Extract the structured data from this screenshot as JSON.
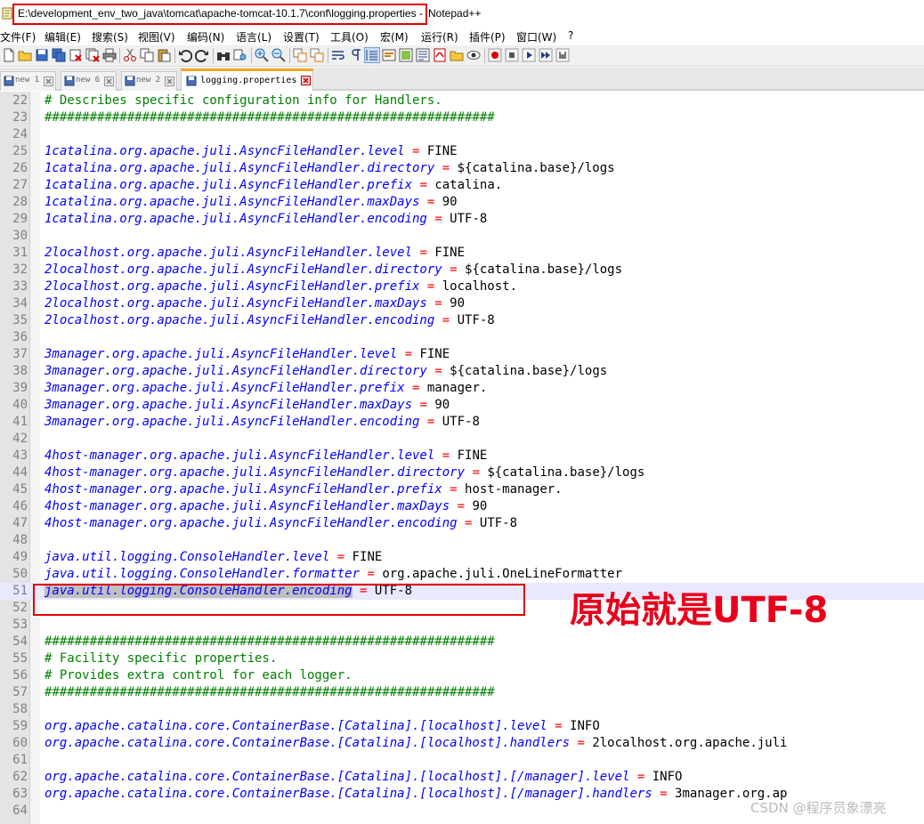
{
  "window": {
    "title_path": "E:\\development_env_two_java\\tomcat\\apache-tomcat-10.1.7\\conf\\logging.properties -",
    "app_name": "Notepad++"
  },
  "menu": [
    {
      "label": "文件(F)"
    },
    {
      "label": "编辑(E)"
    },
    {
      "label": "搜索(S)"
    },
    {
      "label": "视图(V)"
    },
    {
      "label": "编码(N)"
    },
    {
      "label": "语言(L)"
    },
    {
      "label": "设置(T)"
    },
    {
      "label": "工具(O)"
    },
    {
      "label": "宏(M)"
    },
    {
      "label": "运行(R)"
    },
    {
      "label": "插件(P)"
    },
    {
      "label": "窗口(W)"
    },
    {
      "label": "?"
    }
  ],
  "toolbar": {
    "icons": [
      "new-file-icon",
      "open-file-icon",
      "save-icon",
      "save-all-icon",
      "close-icon",
      "close-all-icon",
      "print-icon",
      "cut-icon",
      "copy-icon",
      "paste-icon",
      "undo-icon",
      "redo-icon",
      "find-icon",
      "replace-icon",
      "zoom-in-icon",
      "zoom-out-icon",
      "sync-vertical-icon",
      "sync-horizontal-icon",
      "word-wrap-icon",
      "show-all-chars-icon",
      "indent-guide-icon",
      "user-language-icon",
      "doc-map-icon",
      "function-list-icon",
      "pdf-icon",
      "folder-as-workspace-icon",
      "monitoring-icon",
      "macro-record-icon",
      "macro-stop-icon",
      "macro-play-icon",
      "macro-play-multiple-icon",
      "macro-save-icon"
    ]
  },
  "tabs": [
    {
      "label": "new 1",
      "active": false
    },
    {
      "label": "new 6",
      "active": false
    },
    {
      "label": "new 2",
      "active": false
    },
    {
      "label": "logging.properties",
      "active": true
    }
  ],
  "editor": {
    "current_line": 51,
    "selected_text": "java.util.logging.ConsoleHandler.encoding",
    "lines": [
      {
        "n": "22",
        "type": "comment",
        "text": "# Describes specific configuration info for Handlers."
      },
      {
        "n": "23",
        "type": "comment",
        "text": "############################################################"
      },
      {
        "n": "24",
        "type": "blank"
      },
      {
        "n": "25",
        "type": "prop",
        "key": "1catalina.org.apache.juli.AsyncFileHandler.level",
        "value": "FINE"
      },
      {
        "n": "26",
        "type": "prop",
        "key": "1catalina.org.apache.juli.AsyncFileHandler.directory",
        "value": "${catalina.base}/logs"
      },
      {
        "n": "27",
        "type": "prop",
        "key": "1catalina.org.apache.juli.AsyncFileHandler.prefix",
        "value": "catalina."
      },
      {
        "n": "28",
        "type": "prop",
        "key": "1catalina.org.apache.juli.AsyncFileHandler.maxDays",
        "value": "90"
      },
      {
        "n": "29",
        "type": "prop",
        "key": "1catalina.org.apache.juli.AsyncFileHandler.encoding",
        "value": "UTF-8"
      },
      {
        "n": "30",
        "type": "blank"
      },
      {
        "n": "31",
        "type": "prop",
        "key": "2localhost.org.apache.juli.AsyncFileHandler.level",
        "value": "FINE"
      },
      {
        "n": "32",
        "type": "prop",
        "key": "2localhost.org.apache.juli.AsyncFileHandler.directory",
        "value": "${catalina.base}/logs"
      },
      {
        "n": "33",
        "type": "prop",
        "key": "2localhost.org.apache.juli.AsyncFileHandler.prefix",
        "value": "localhost."
      },
      {
        "n": "34",
        "type": "prop",
        "key": "2localhost.org.apache.juli.AsyncFileHandler.maxDays",
        "value": "90"
      },
      {
        "n": "35",
        "type": "prop",
        "key": "2localhost.org.apache.juli.AsyncFileHandler.encoding",
        "value": "UTF-8"
      },
      {
        "n": "36",
        "type": "blank"
      },
      {
        "n": "37",
        "type": "prop",
        "key": "3manager.org.apache.juli.AsyncFileHandler.level",
        "value": "FINE"
      },
      {
        "n": "38",
        "type": "prop",
        "key": "3manager.org.apache.juli.AsyncFileHandler.directory",
        "value": "${catalina.base}/logs"
      },
      {
        "n": "39",
        "type": "prop",
        "key": "3manager.org.apache.juli.AsyncFileHandler.prefix",
        "value": "manager."
      },
      {
        "n": "40",
        "type": "prop",
        "key": "3manager.org.apache.juli.AsyncFileHandler.maxDays",
        "value": "90"
      },
      {
        "n": "41",
        "type": "prop",
        "key": "3manager.org.apache.juli.AsyncFileHandler.encoding",
        "value": "UTF-8"
      },
      {
        "n": "42",
        "type": "blank"
      },
      {
        "n": "43",
        "type": "prop",
        "key": "4host-manager.org.apache.juli.AsyncFileHandler.level",
        "value": "FINE"
      },
      {
        "n": "44",
        "type": "prop",
        "key": "4host-manager.org.apache.juli.AsyncFileHandler.directory",
        "value": "${catalina.base}/logs"
      },
      {
        "n": "45",
        "type": "prop",
        "key": "4host-manager.org.apache.juli.AsyncFileHandler.prefix",
        "value": "host-manager."
      },
      {
        "n": "46",
        "type": "prop",
        "key": "4host-manager.org.apache.juli.AsyncFileHandler.maxDays",
        "value": "90"
      },
      {
        "n": "47",
        "type": "prop",
        "key": "4host-manager.org.apache.juli.AsyncFileHandler.encoding",
        "value": "UTF-8"
      },
      {
        "n": "48",
        "type": "blank"
      },
      {
        "n": "49",
        "type": "prop",
        "key": "java.util.logging.ConsoleHandler.level",
        "value": "FINE"
      },
      {
        "n": "50",
        "type": "prop",
        "key": "java.util.logging.ConsoleHandler.formatter",
        "value": "org.apache.juli.OneLineFormatter"
      },
      {
        "n": "51",
        "type": "prop",
        "key": "java.util.logging.ConsoleHandler.encoding",
        "value": "UTF-8"
      },
      {
        "n": "52",
        "type": "blank"
      },
      {
        "n": "53",
        "type": "blank"
      },
      {
        "n": "54",
        "type": "comment",
        "text": "############################################################"
      },
      {
        "n": "55",
        "type": "comment",
        "text": "# Facility specific properties."
      },
      {
        "n": "56",
        "type": "comment",
        "text": "# Provides extra control for each logger."
      },
      {
        "n": "57",
        "type": "comment",
        "text": "############################################################"
      },
      {
        "n": "58",
        "type": "blank"
      },
      {
        "n": "59",
        "type": "prop",
        "key": "org.apache.catalina.core.ContainerBase.[Catalina].[localhost].level",
        "value": "INFO"
      },
      {
        "n": "60",
        "type": "prop",
        "key": "org.apache.catalina.core.ContainerBase.[Catalina].[localhost].handlers",
        "value": "2localhost.org.apache.juli"
      },
      {
        "n": "61",
        "type": "blank"
      },
      {
        "n": "62",
        "type": "prop",
        "key": "org.apache.catalina.core.ContainerBase.[Catalina].[localhost].[/manager].level",
        "value": "INFO"
      },
      {
        "n": "63",
        "type": "prop",
        "key": "org.apache.catalina.core.ContainerBase.[Catalina].[localhost].[/manager].handlers",
        "value": "3manager.org.ap"
      },
      {
        "n": "64",
        "type": "blank"
      }
    ]
  },
  "annotation": {
    "text": "原始就是UTF-8",
    "color": "#e8001c"
  },
  "watermark": "CSDN @程序员象漂亮",
  "colors": {
    "comment": "#008000",
    "key": "#0000ff",
    "operator": "#ff0000",
    "value": "#000000",
    "active_tab_accent": "#f5a623",
    "highlight_box": "#e00000"
  }
}
